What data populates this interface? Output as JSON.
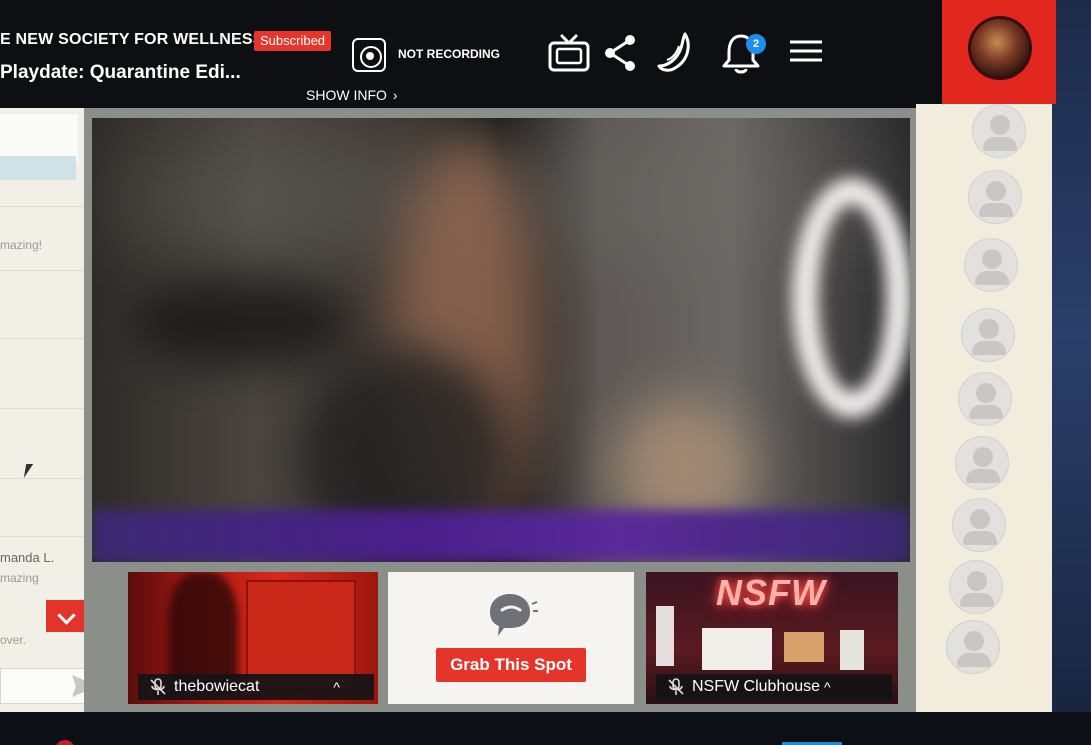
{
  "header": {
    "channel_name": "E NEW SOCIETY FOR WELLNESS",
    "subscribed_badge": "Subscribed",
    "stream_title": "Playdate: Quarantine Edi...",
    "recording_status": "NOT RECORDING",
    "show_info": "SHOW INFO",
    "notification_count": "2",
    "icons": [
      "tv-icon",
      "share-icon",
      "banana-icon",
      "bell-icon",
      "menu-icon"
    ]
  },
  "chat": {
    "messages": [
      {
        "text": "mazing!"
      },
      {
        "name": "manda L.",
        "text": "mazing"
      },
      {
        "text": "over."
      }
    ]
  },
  "tiles": [
    {
      "name": "thebowiecat",
      "muted": true
    },
    {
      "cta": "Grab This Spot"
    },
    {
      "name": "NSFW Clubhouse",
      "muted": true,
      "sign": "NSFW"
    }
  ],
  "colors": {
    "accent": "#e2271f",
    "header_bg": "#0e0f12",
    "badge": "#1f8ee8",
    "viewer_panel": "#f1ecdc"
  }
}
